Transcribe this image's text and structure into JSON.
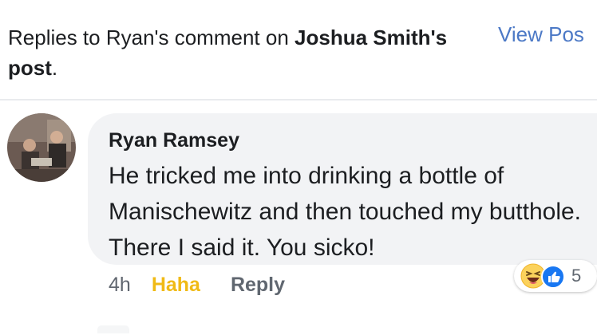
{
  "header": {
    "prefix": "Replies to Ryan's comment on ",
    "post_owner": "Joshua Smith's",
    "post_word": "post",
    "suffix": ".",
    "view_post_label": "View Pos"
  },
  "comment": {
    "author": "Ryan Ramsey",
    "text": "He tricked me into drinking a bottle of Manischewitz and then touched my butthole. There I said it. You sicko!",
    "time": "4h",
    "reaction_label": "Haha",
    "reply_label": "Reply",
    "reaction_count": "5",
    "reaction_icons": [
      "haha-emoji-icon",
      "like-thumb-icon"
    ]
  },
  "colors": {
    "link_blue": "#4c79c6",
    "haha_yellow": "#f0ba15",
    "bubble_bg": "#f2f3f5",
    "like_blue": "#1877f2"
  }
}
